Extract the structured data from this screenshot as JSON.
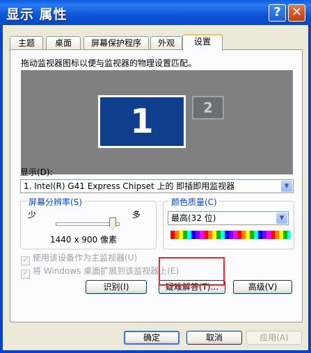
{
  "window": {
    "title": "显示 属性",
    "help_glyph": "?",
    "close_glyph": "✕"
  },
  "tabs": [
    "主题",
    "桌面",
    "屏幕保护程序",
    "外观",
    "设置"
  ],
  "settings": {
    "description": "拖动监视器图标以便与监视器的物理设置匹配。",
    "monitor1_label": "1",
    "monitor2_label": "2",
    "display_label": "显示(D):",
    "display_value": "1. Intel(R) G41 Express Chipset 上的 即插即用监视器",
    "resolution": {
      "title": "屏幕分辨率(S)",
      "min_label": "少",
      "max_label": "多",
      "value_text": "1440 x 900 像素"
    },
    "color_quality": {
      "title": "颜色质量(C)",
      "value": "最高(32 位)"
    },
    "checkbox_primary": "使用该设备作为主监视器(U)",
    "checkbox_extend": "将 Windows 桌面扩展到该监视器上(E)",
    "identify_button": "识别(I)",
    "troubleshoot_button": "疑难解答(T)...",
    "advanced_button": "高级(V)"
  },
  "dialog_buttons": {
    "ok": "确定",
    "cancel": "取消",
    "apply": "应用(A)"
  }
}
